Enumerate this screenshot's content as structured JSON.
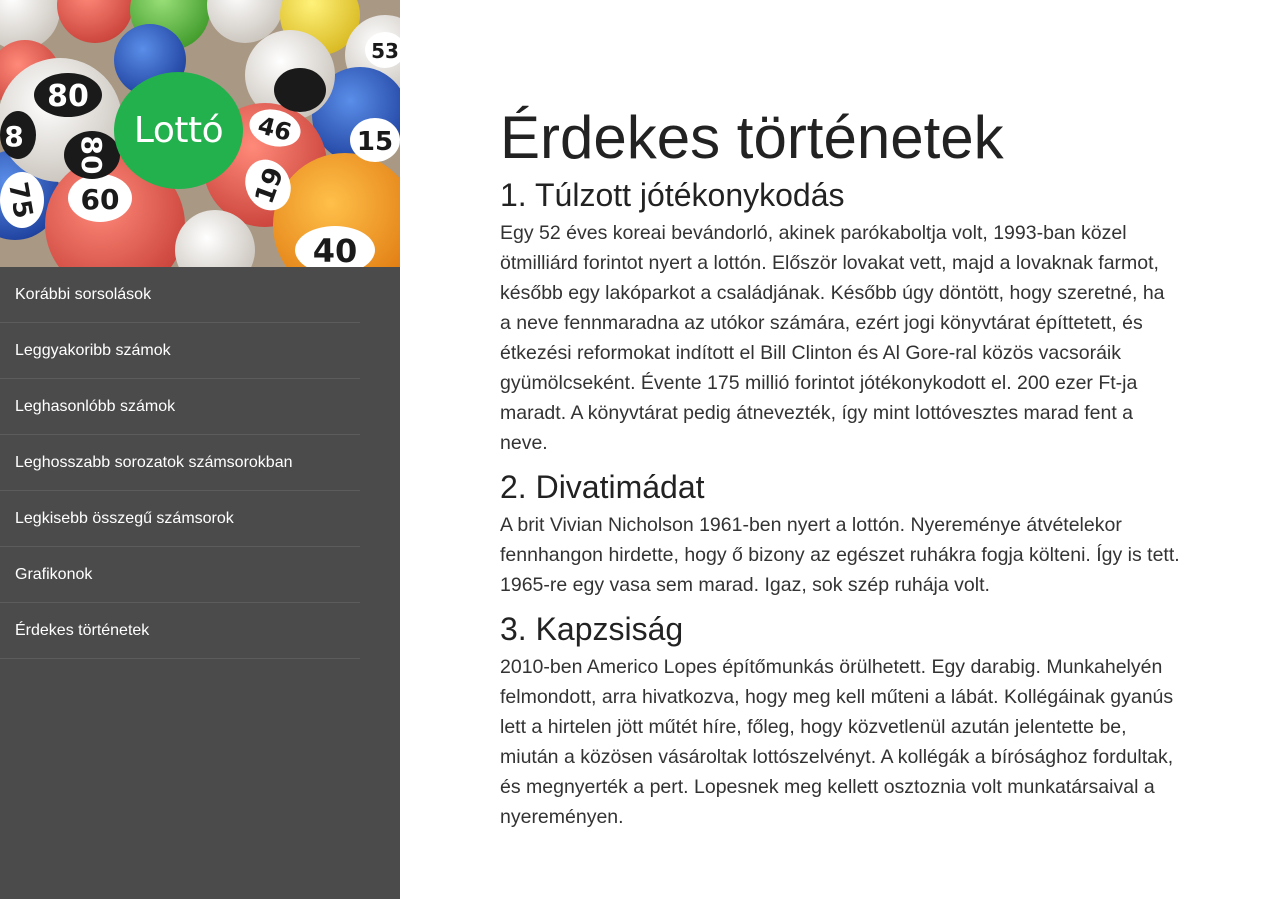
{
  "logo": {
    "text": "Lottó",
    "color": "#22b14c"
  },
  "nav": {
    "items": [
      {
        "label": "Korábbi sorsolások"
      },
      {
        "label": "Leggyakoribb számok"
      },
      {
        "label": "Leghasonlóbb számok"
      },
      {
        "label": "Leghosszabb sorozatok számsorokban"
      },
      {
        "label": "Legkisebb összegű számsorok"
      },
      {
        "label": "Grafikonok"
      },
      {
        "label": "Érdekes történetek"
      }
    ]
  },
  "hero": {
    "ball_numbers": [
      "80",
      "46",
      "8",
      "15",
      "75",
      "60",
      "19",
      "80",
      "40",
      "53"
    ]
  },
  "main": {
    "title": "Érdekes történetek",
    "stories": [
      {
        "heading": "1. Túlzott jótékonykodás",
        "body": "Egy 52 éves koreai bevándorló, akinek parókaboltja volt, 1993-ban közel ötmilliárd forintot nyert a lottón. Először lovakat vett, majd a lovaknak farmot, később egy lakóparkot a családjának. Később úgy döntött, hogy szeretné, ha a neve fennmaradna az utókor számára, ezért jogi könyvtárat építtetett, és étkezési reformokat indított el Bill Clinton és Al Gore-ral közös vacsoráik gyümölcseként. Évente 175 millió forintot jótékonykodott el. 200 ezer Ft-ja maradt. A könyvtárat pedig átnevezték, így mint lottóvesztes marad fent a neve."
      },
      {
        "heading": "2. Divatimádat",
        "body": "A brit Vivian Nicholson 1961-ben nyert a lottón. Nyereménye átvételekor fennhangon hirdette, hogy ő bizony az egészet ruhákra fogja költeni. Így is tett. 1965-re egy vasa sem marad. Igaz, sok szép ruhája volt."
      },
      {
        "heading": "3. Kapzsiság",
        "body": "2010-ben Americo Lopes építőmunkás örülhetett. Egy darabig. Munkahelyén felmondott, arra hivatkozva, hogy meg kell műteni a lábát. Kollégáinak gyanús lett a hirtelen jött műtét híre, főleg, hogy közvetlenül azután jelentette be, miután a közösen vásároltak lottószelvényt. A kollégák a bírósághoz fordultak, és megnyerték a pert. Lopesnek meg kellett osztoznia volt munkatársaival a nyereményen."
      }
    ]
  }
}
